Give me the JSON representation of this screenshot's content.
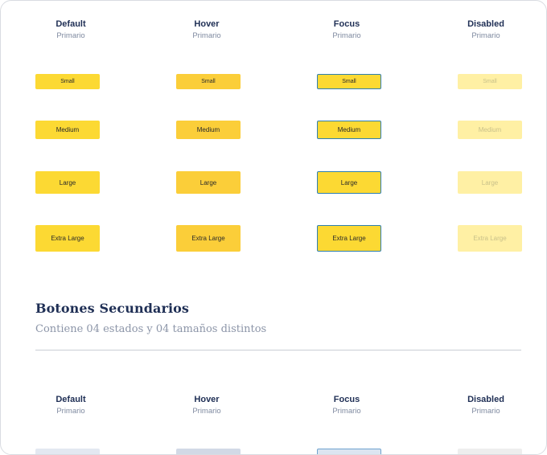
{
  "primary": {
    "columns": [
      {
        "state": "Default",
        "variant": "Primario"
      },
      {
        "state": "Hover",
        "variant": "Primario"
      },
      {
        "state": "Focus",
        "variant": "Primario"
      },
      {
        "state": "Disabled",
        "variant": "Primario"
      }
    ],
    "sizes": [
      "Small",
      "Medium",
      "Large",
      "Extra Large"
    ]
  },
  "secondary": {
    "title": "Botones Secundarios",
    "subtitle": "Contiene 04 estados y 04 tamaños distintos",
    "columns": [
      {
        "state": "Default",
        "variant": "Primario"
      },
      {
        "state": "Hover",
        "variant": "Primario"
      },
      {
        "state": "Focus",
        "variant": "Primario"
      },
      {
        "state": "Disabled",
        "variant": "Primario"
      }
    ]
  },
  "colors": {
    "primary_default": "#fcd933",
    "primary_hover": "#fbce39",
    "primary_focus_border": "#2e7fb1",
    "primary_disabled": "#fff0a4",
    "heading": "#1f2f55",
    "muted": "#8c95a8"
  }
}
